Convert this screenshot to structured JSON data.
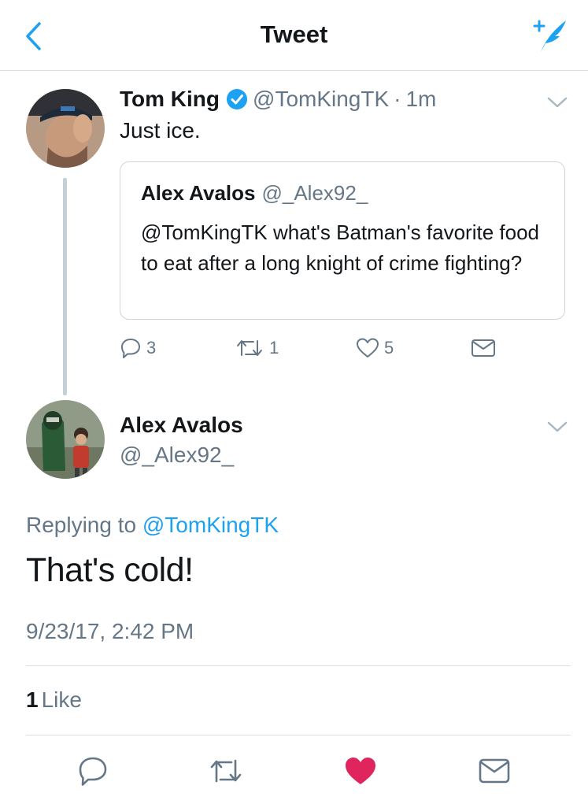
{
  "header": {
    "title": "Tweet",
    "back_icon": "chevron-left-icon",
    "compose_icon": "compose-tweet-icon"
  },
  "tweet1": {
    "name": "Tom King",
    "handle": "@TomKingTK",
    "separator": "·",
    "time": "1m",
    "text": "Just ice.",
    "quote": {
      "name": "Alex Avalos",
      "handle": "@_Alex92_",
      "text": "@TomKingTK what's Batman's favorite food to eat after a long knight of crime fighting?"
    },
    "actions": {
      "replies": "3",
      "retweets": "1",
      "likes": "5"
    }
  },
  "tweet2": {
    "name": "Alex Avalos",
    "handle": "@_Alex92_",
    "replying_prefix": "Replying to",
    "replying_to": "@TomKingTK",
    "text": "That's cold!",
    "timestamp": "9/23/17, 2:42 PM",
    "like_count": "1",
    "like_label": "Like"
  },
  "colors": {
    "accent": "#1da1f2",
    "like": "#e0245e",
    "muted": "#657786",
    "text": "#14171a"
  }
}
